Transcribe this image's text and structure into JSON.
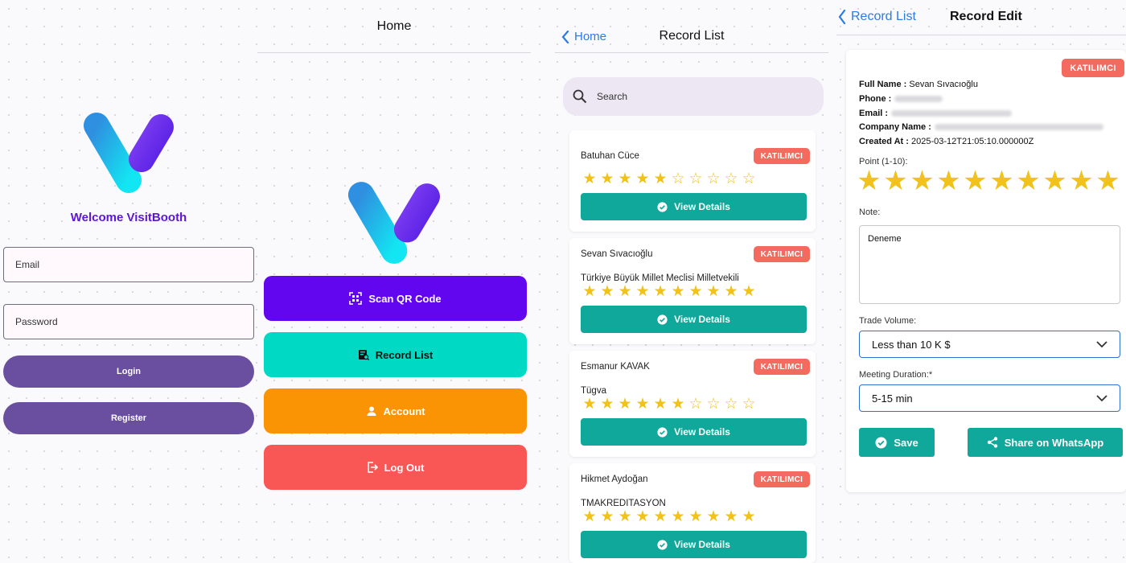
{
  "colors": {
    "brand_purple": "#5b16d6",
    "teal": "#0fa89a",
    "badge_red": "#f46a5e",
    "star_gold": "#f0c21a",
    "link_blue": "#2a7be4"
  },
  "login": {
    "welcome": "Welcome VisitBooth",
    "email_placeholder": "Email",
    "password_placeholder": "Password",
    "login_label": "Login",
    "register_label": "Register"
  },
  "home": {
    "title": "Home",
    "buttons": [
      {
        "label": "Scan QR Code",
        "icon": "qr-scan-icon",
        "color": "#6106ee"
      },
      {
        "label": "Record List",
        "icon": "list-search-icon",
        "color": "#00dac5"
      },
      {
        "label": "Account",
        "icon": "person-icon",
        "color": "#fb9404"
      },
      {
        "label": "Log Out",
        "icon": "logout-icon",
        "color": "#f95656"
      }
    ]
  },
  "record_list": {
    "back_label": "Home",
    "title": "Record List",
    "search_placeholder": "Search",
    "view_details_label": "View Details",
    "records": [
      {
        "name": "Batuhan Cüce",
        "company": "",
        "badge": "KATILIMCI",
        "rating": 5,
        "max": 10
      },
      {
        "name": "Sevan Sıvacıoğlu",
        "company": "Türkiye Büyük Millet Meclisi Milletvekili",
        "badge": "KATILIMCI",
        "rating": 10,
        "max": 10
      },
      {
        "name": "Esmanur KAVAK",
        "company": "Tügva",
        "badge": "KATILIMCI",
        "rating": 6,
        "max": 10
      },
      {
        "name": "Hikmet Aydoğan",
        "company": "TMAKREDITASYON",
        "badge": "KATILIMCI",
        "rating": 10,
        "max": 10
      }
    ]
  },
  "record_edit": {
    "back_label": "Record List",
    "title": "Record Edit",
    "badge": "KATILIMCI",
    "full_name_label": "Full Name :",
    "full_name": "Sevan Sıvacıoğlu",
    "phone_label": "Phone :",
    "email_label": "Email :",
    "company_label": "Company Name :",
    "created_label": "Created At :",
    "created_at": "2025-03-12T21:05:10.000000Z",
    "point_label": "Point (1-10):",
    "point": 10,
    "note_label": "Note:",
    "note_value": "Deneme",
    "trade_label": "Trade Volume:",
    "trade_value": "Less than 10 K $",
    "duration_label": "Meeting Duration:*",
    "duration_value": "5-15 min",
    "save_label": "Save",
    "share_label": "Share on WhatsApp"
  }
}
